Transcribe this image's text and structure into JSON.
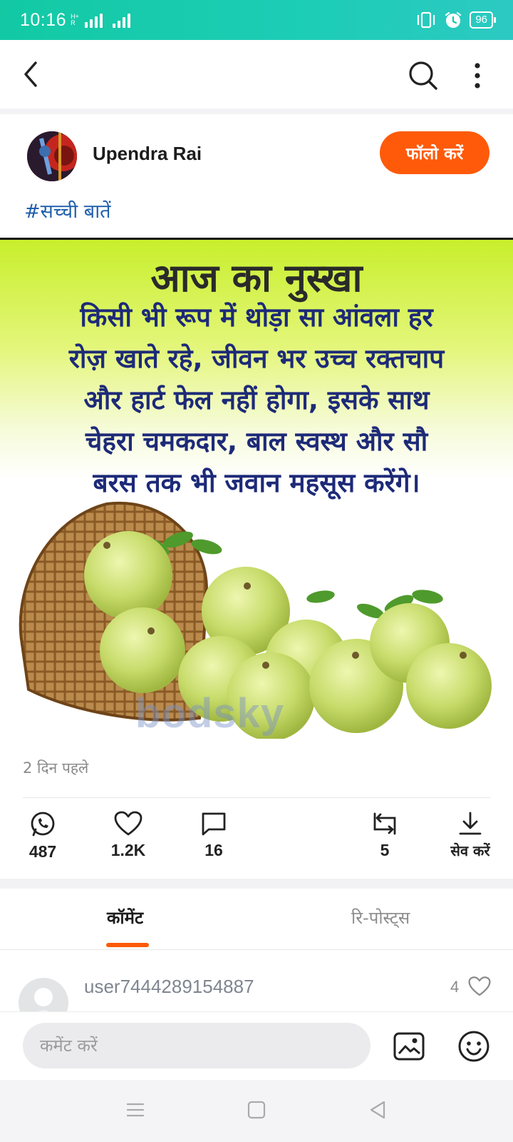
{
  "status_bar": {
    "time": "10:16",
    "network_label": "H+ R",
    "battery": "96"
  },
  "post": {
    "author": "Upendra Rai",
    "follow_label": "फॉलो करें",
    "hashtag": "#सच्ची बातें",
    "image": {
      "title": "आज का नुस्खा",
      "lines": [
        "किसी भी रूप में थोड़ा सा आंवला हर",
        "रोज़ खाते रहे, जीवन भर उच्च रक्तचाप",
        "और हार्ट फेल नहीं होगा, इसके साथ",
        "चेहरा चमकदार, बाल स्वस्थ और सौ",
        "बरस तक भी जवान महसूस करेंगे।"
      ],
      "watermark": "bodsky"
    },
    "time_ago": "2 दिन पहले",
    "actions": {
      "whatsapp_count": "487",
      "like_count": "1.2K",
      "comment_count": "16",
      "repost_count": "5",
      "save_label": "सेव करें"
    }
  },
  "tabs": {
    "comments": "कॉमेंट",
    "reposts": "रि-पोस्ट्स"
  },
  "comment": {
    "user": "user7444289154887",
    "likes": "4"
  },
  "comment_input": {
    "placeholder": "कमेंट करें"
  },
  "colors": {
    "accent": "#fe5a0a",
    "status_bar": "#12c9a4",
    "hashtag": "#1f5fae"
  }
}
